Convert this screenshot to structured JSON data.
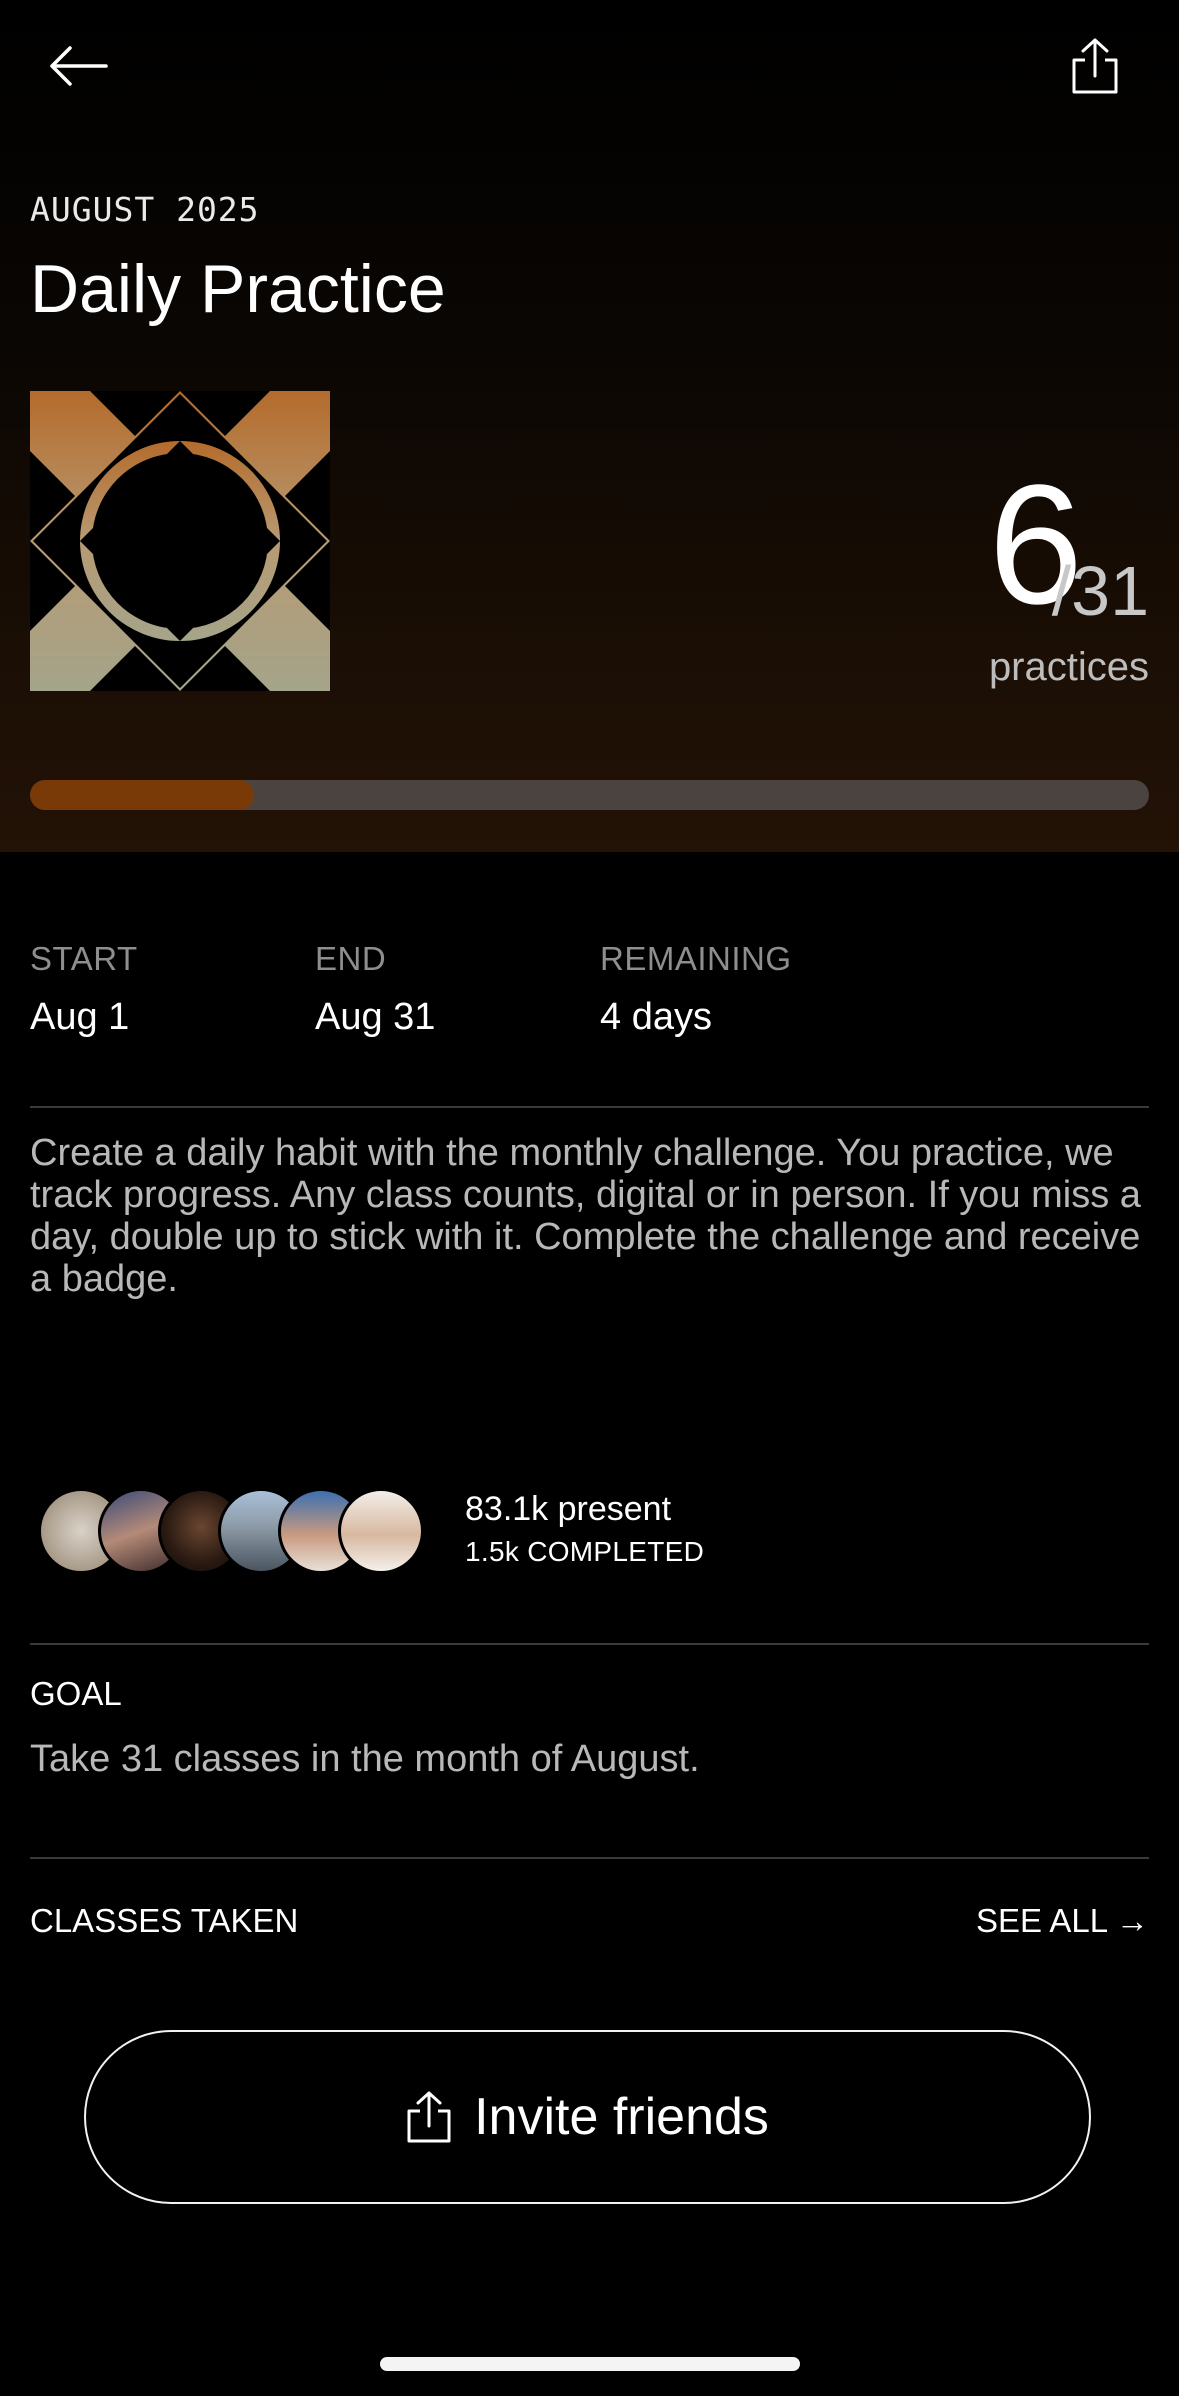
{
  "header": {
    "back_icon": "arrow-left-icon",
    "share_icon": "share-icon"
  },
  "challenge": {
    "month": "AUGUST 2025",
    "title": "Daily Practice",
    "completed_count": "6",
    "total_label": "/31",
    "unit": "practices",
    "progress_fraction": 0.2,
    "progress_color": "#7a3a08",
    "track_color": "#4a4340"
  },
  "meta": {
    "start_label": "START",
    "start_value": "Aug 1",
    "end_label": "END",
    "end_value": "Aug 31",
    "remaining_label": "REMAINING",
    "remaining_value": "4 days"
  },
  "description": "Create a daily habit with the monthly challenge. You practice, we track progress. Any class counts, digital or in person. If you miss a day, double up to stick with it. Complete the challenge and receive a badge.",
  "community": {
    "present": "83.1k present",
    "completed": "1.5k COMPLETED"
  },
  "goal": {
    "label": "GOAL",
    "text": "Take 31 classes in the month of August."
  },
  "classes": {
    "label": "CLASSES TAKEN",
    "see_all": "SEE ALL →"
  },
  "invite": {
    "label": "Invite friends",
    "icon": "share-icon"
  }
}
